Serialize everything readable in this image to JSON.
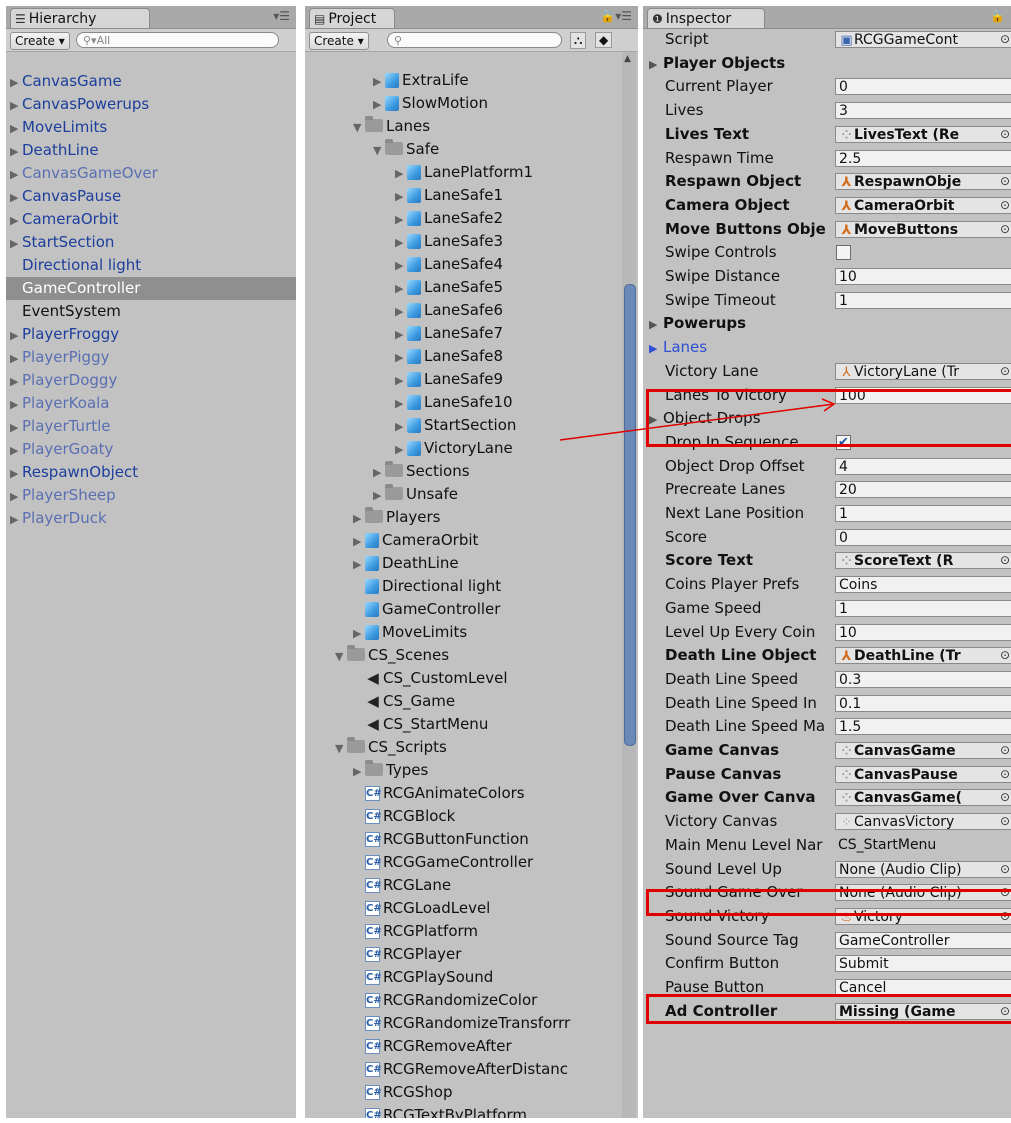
{
  "hierarchy": {
    "tab_label": "Hierarchy",
    "create_label": "Create",
    "search_placeholder": "All",
    "items": [
      {
        "label": "CanvasGame",
        "arrow": true,
        "style": "blue"
      },
      {
        "label": "CanvasPowerups",
        "arrow": true,
        "style": "blue"
      },
      {
        "label": "MoveLimits",
        "arrow": true,
        "style": "blue"
      },
      {
        "label": "DeathLine",
        "arrow": true,
        "style": "blue"
      },
      {
        "label": "CanvasGameOver",
        "arrow": true,
        "style": "light"
      },
      {
        "label": "CanvasPause",
        "arrow": true,
        "style": "blue"
      },
      {
        "label": "CameraOrbit",
        "arrow": true,
        "style": "blue"
      },
      {
        "label": "StartSection",
        "arrow": true,
        "style": "blue"
      },
      {
        "label": "Directional light",
        "arrow": false,
        "style": "blue"
      },
      {
        "label": "GameController",
        "arrow": false,
        "style": "white",
        "selected": true
      },
      {
        "label": "EventSystem",
        "arrow": false,
        "style": "black"
      },
      {
        "label": "PlayerFroggy",
        "arrow": true,
        "style": "blue"
      },
      {
        "label": "PlayerPiggy",
        "arrow": true,
        "style": "light"
      },
      {
        "label": "PlayerDoggy",
        "arrow": true,
        "style": "light"
      },
      {
        "label": "PlayerKoala",
        "arrow": true,
        "style": "light"
      },
      {
        "label": "PlayerTurtle",
        "arrow": true,
        "style": "light"
      },
      {
        "label": "PlayerGoaty",
        "arrow": true,
        "style": "light"
      },
      {
        "label": "RespawnObject",
        "arrow": true,
        "style": "blue"
      },
      {
        "label": "PlayerSheep",
        "arrow": true,
        "style": "light"
      },
      {
        "label": "PlayerDuck",
        "arrow": true,
        "style": "light"
      }
    ]
  },
  "project": {
    "tab_label": "Project",
    "create_label": "Create",
    "items": [
      {
        "label": "ExtraLife",
        "indent": 3,
        "icon": "cube",
        "arrow": "right"
      },
      {
        "label": "SlowMotion",
        "indent": 3,
        "icon": "cube",
        "arrow": "right"
      },
      {
        "label": "Lanes",
        "indent": 2,
        "icon": "folder",
        "arrow": "down"
      },
      {
        "label": "Safe",
        "indent": 3,
        "icon": "folder",
        "arrow": "down"
      },
      {
        "label": "LanePlatform1",
        "indent": 4,
        "icon": "cube",
        "arrow": "right"
      },
      {
        "label": "LaneSafe1",
        "indent": 4,
        "icon": "cube",
        "arrow": "right"
      },
      {
        "label": "LaneSafe2",
        "indent": 4,
        "icon": "cube",
        "arrow": "right"
      },
      {
        "label": "LaneSafe3",
        "indent": 4,
        "icon": "cube",
        "arrow": "right"
      },
      {
        "label": "LaneSafe4",
        "indent": 4,
        "icon": "cube",
        "arrow": "right"
      },
      {
        "label": "LaneSafe5",
        "indent": 4,
        "icon": "cube",
        "arrow": "right"
      },
      {
        "label": "LaneSafe6",
        "indent": 4,
        "icon": "cube",
        "arrow": "right"
      },
      {
        "label": "LaneSafe7",
        "indent": 4,
        "icon": "cube",
        "arrow": "right"
      },
      {
        "label": "LaneSafe8",
        "indent": 4,
        "icon": "cube",
        "arrow": "right"
      },
      {
        "label": "LaneSafe9",
        "indent": 4,
        "icon": "cube",
        "arrow": "right"
      },
      {
        "label": "LaneSafe10",
        "indent": 4,
        "icon": "cube",
        "arrow": "right"
      },
      {
        "label": "StartSection",
        "indent": 4,
        "icon": "cube",
        "arrow": "right"
      },
      {
        "label": "VictoryLane",
        "indent": 4,
        "icon": "cube",
        "arrow": "right"
      },
      {
        "label": "Sections",
        "indent": 3,
        "icon": "folder",
        "arrow": "right"
      },
      {
        "label": "Unsafe",
        "indent": 3,
        "icon": "folder",
        "arrow": "right"
      },
      {
        "label": "Players",
        "indent": 2,
        "icon": "folder",
        "arrow": "right"
      },
      {
        "label": "CameraOrbit",
        "indent": 2,
        "icon": "cube",
        "arrow": "right"
      },
      {
        "label": "DeathLine",
        "indent": 2,
        "icon": "cube",
        "arrow": "right"
      },
      {
        "label": "Directional light",
        "indent": 2,
        "icon": "cube",
        "arrow": "none"
      },
      {
        "label": "GameController",
        "indent": 2,
        "icon": "cube",
        "arrow": "none"
      },
      {
        "label": "MoveLimits",
        "indent": 2,
        "icon": "cube",
        "arrow": "right"
      },
      {
        "label": "CS_Scenes",
        "indent": 1,
        "icon": "folder",
        "arrow": "down"
      },
      {
        "label": "CS_CustomLevel",
        "indent": 2,
        "icon": "scene",
        "arrow": "none"
      },
      {
        "label": "CS_Game",
        "indent": 2,
        "icon": "scene",
        "arrow": "none"
      },
      {
        "label": "CS_StartMenu",
        "indent": 2,
        "icon": "scene",
        "arrow": "none"
      },
      {
        "label": "CS_Scripts",
        "indent": 1,
        "icon": "folder",
        "arrow": "down"
      },
      {
        "label": "Types",
        "indent": 2,
        "icon": "folder",
        "arrow": "right"
      },
      {
        "label": "RCGAnimateColors",
        "indent": 2,
        "icon": "cs",
        "arrow": "none"
      },
      {
        "label": "RCGBlock",
        "indent": 2,
        "icon": "cs",
        "arrow": "none"
      },
      {
        "label": "RCGButtonFunction",
        "indent": 2,
        "icon": "cs",
        "arrow": "none"
      },
      {
        "label": "RCGGameController",
        "indent": 2,
        "icon": "cs",
        "arrow": "none"
      },
      {
        "label": "RCGLane",
        "indent": 2,
        "icon": "cs",
        "arrow": "none"
      },
      {
        "label": "RCGLoadLevel",
        "indent": 2,
        "icon": "cs",
        "arrow": "none"
      },
      {
        "label": "RCGPlatform",
        "indent": 2,
        "icon": "cs",
        "arrow": "none"
      },
      {
        "label": "RCGPlayer",
        "indent": 2,
        "icon": "cs",
        "arrow": "none"
      },
      {
        "label": "RCGPlaySound",
        "indent": 2,
        "icon": "cs",
        "arrow": "none"
      },
      {
        "label": "RCGRandomizeColor",
        "indent": 2,
        "icon": "cs",
        "arrow": "none"
      },
      {
        "label": "RCGRandomizeTransforrr",
        "indent": 2,
        "icon": "cs",
        "arrow": "none"
      },
      {
        "label": "RCGRemoveAfter",
        "indent": 2,
        "icon": "cs",
        "arrow": "none"
      },
      {
        "label": "RCGRemoveAfterDistanc",
        "indent": 2,
        "icon": "cs",
        "arrow": "none"
      },
      {
        "label": "RCGShop",
        "indent": 2,
        "icon": "cs",
        "arrow": "none"
      },
      {
        "label": "RCGTextByPlatform",
        "indent": 2,
        "icon": "cs",
        "arrow": "none"
      }
    ]
  },
  "inspector": {
    "tab_label": "Inspector",
    "rows": [
      {
        "kind": "field",
        "label": "Script",
        "value": "RCGGameCont",
        "ref": "script",
        "dot": true
      },
      {
        "kind": "header",
        "label": "Player Objects",
        "bold": true
      },
      {
        "kind": "field",
        "label": "Current Player",
        "value": "0"
      },
      {
        "kind": "field",
        "label": "Lives",
        "value": "3"
      },
      {
        "kind": "field",
        "label": "Lives Text",
        "value": "LivesText (Re",
        "ref": "ui",
        "bold": true,
        "dot": true
      },
      {
        "kind": "field",
        "label": "Respawn Time",
        "value": "2.5"
      },
      {
        "kind": "field",
        "label": "Respawn Object",
        "value": "RespawnObje",
        "ref": "go",
        "bold": true,
        "dot": true
      },
      {
        "kind": "field",
        "label": "Camera Object",
        "value": "CameraOrbit",
        "ref": "go",
        "bold": true,
        "dot": true
      },
      {
        "kind": "field",
        "label": "Move Buttons Obje",
        "value": "MoveButtons",
        "ref": "go",
        "bold": true,
        "dot": true
      },
      {
        "kind": "check",
        "label": "Swipe Controls",
        "checked": false
      },
      {
        "kind": "field",
        "label": "Swipe Distance",
        "value": "10"
      },
      {
        "kind": "field",
        "label": "Swipe Timeout",
        "value": "1"
      },
      {
        "kind": "header",
        "label": "Powerups",
        "bold": true
      },
      {
        "kind": "header",
        "label": "Lanes",
        "bold": false,
        "blue": true
      },
      {
        "kind": "field",
        "label": "Victory Lane",
        "value": "VictoryLane (Tr",
        "ref": "go",
        "dot": true
      },
      {
        "kind": "field",
        "label": "Lanes To Victory",
        "value": "100"
      },
      {
        "kind": "header",
        "label": "Object Drops",
        "bold": false
      },
      {
        "kind": "check",
        "label": "Drop In Sequence",
        "checked": true
      },
      {
        "kind": "field",
        "label": "Object Drop Offset",
        "value": "4"
      },
      {
        "kind": "field",
        "label": "Precreate Lanes",
        "value": "20"
      },
      {
        "kind": "field",
        "label": "Next Lane Position",
        "value": "1"
      },
      {
        "kind": "field",
        "label": "Score",
        "value": "0"
      },
      {
        "kind": "field",
        "label": "Score Text",
        "value": "ScoreText (R",
        "ref": "ui",
        "bold": true,
        "dot": true
      },
      {
        "kind": "field",
        "label": "Coins Player Prefs",
        "value": "Coins"
      },
      {
        "kind": "field",
        "label": "Game Speed",
        "value": "1"
      },
      {
        "kind": "field",
        "label": "Level Up Every Coin",
        "value": "10"
      },
      {
        "kind": "field",
        "label": "Death Line Object",
        "value": "DeathLine (Tr",
        "ref": "go",
        "bold": true,
        "dot": true
      },
      {
        "kind": "field",
        "label": "Death Line Speed",
        "value": "0.3"
      },
      {
        "kind": "field",
        "label": "Death Line Speed In",
        "value": "0.1"
      },
      {
        "kind": "field",
        "label": "Death Line Speed Ma",
        "value": "1.5"
      },
      {
        "kind": "field",
        "label": "Game Canvas",
        "value": "CanvasGame",
        "ref": "ui",
        "bold": true,
        "dot": true
      },
      {
        "kind": "field",
        "label": "Pause Canvas",
        "value": "CanvasPause",
        "ref": "ui",
        "bold": true,
        "dot": true
      },
      {
        "kind": "field",
        "label": "Game Over Canva",
        "value": "CanvasGame(",
        "ref": "ui",
        "bold": true,
        "dot": true
      },
      {
        "kind": "field",
        "label": "Victory Canvas",
        "value": "CanvasVictory",
        "ref": "ui",
        "dot": true
      },
      {
        "kind": "field",
        "label": "Main Menu Level Nar",
        "value": "CS_StartMenu",
        "nobox": true
      },
      {
        "kind": "field",
        "label": "Sound Level Up",
        "value": "None (Audio Clip)",
        "ref": "plain",
        "dot": true
      },
      {
        "kind": "field",
        "label": "Sound Game Over",
        "value": "None (Audio Clip)",
        "ref": "plain",
        "dot": true
      },
      {
        "kind": "field",
        "label": "Sound Victory",
        "value": "Victory",
        "ref": "audio",
        "dot": true
      },
      {
        "kind": "field",
        "label": "Sound Source Tag",
        "value": "GameController"
      },
      {
        "kind": "field",
        "label": "Confirm Button",
        "value": "Submit"
      },
      {
        "kind": "field",
        "label": "Pause Button",
        "value": "Cancel"
      },
      {
        "kind": "field",
        "label": "Ad Controller",
        "value": "Missing (Game",
        "ref": "plain",
        "bold": true,
        "dot": true
      }
    ]
  },
  "colors": {
    "panel_bg": "#c2c2c2",
    "selection": "#8f8f8f",
    "hier_blue": "#1c3e9c",
    "hier_light": "#5a6fb3",
    "highlight_red": "#e00000",
    "scroll_thumb": "#6a88b8"
  }
}
